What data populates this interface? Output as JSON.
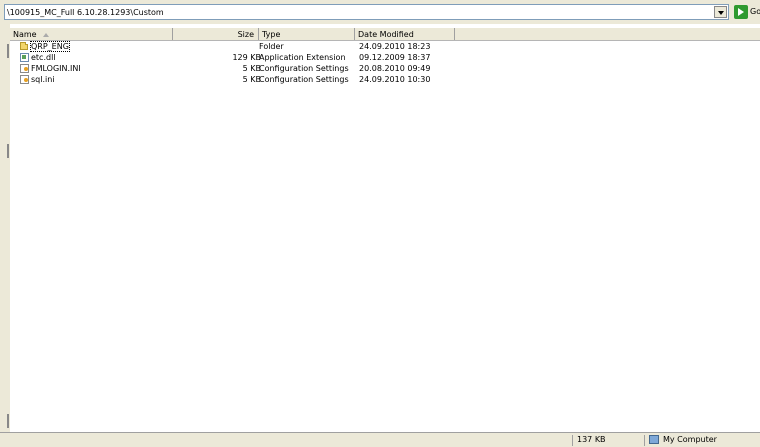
{
  "address_bar": {
    "path": "\\100915_MC_Full 6.10.28.1293\\Custom",
    "go_label": "Go"
  },
  "columns": {
    "name": "Name",
    "size": "Size",
    "type": "Type",
    "date": "Date Modified"
  },
  "files": [
    {
      "name": "QRP_ENG",
      "size": "",
      "type": "Folder",
      "date": "24.09.2010 18:23",
      "icon": "folder-icon"
    },
    {
      "name": "etc.dll",
      "size": "129 KB",
      "type": "Application Extension",
      "date": "09.12.2009 18:37",
      "icon": "dll-icon"
    },
    {
      "name": "FMLOGIN.INI",
      "size": "5 KB",
      "type": "Configuration Settings",
      "date": "20.08.2010 09:49",
      "icon": "ini-icon"
    },
    {
      "name": "sql.ini",
      "size": "5 KB",
      "type": "Configuration Settings",
      "date": "24.09.2010 10:30",
      "icon": "ini-icon"
    }
  ],
  "status_bar": {
    "total_size": "137 KB",
    "zone": "My Computer"
  }
}
